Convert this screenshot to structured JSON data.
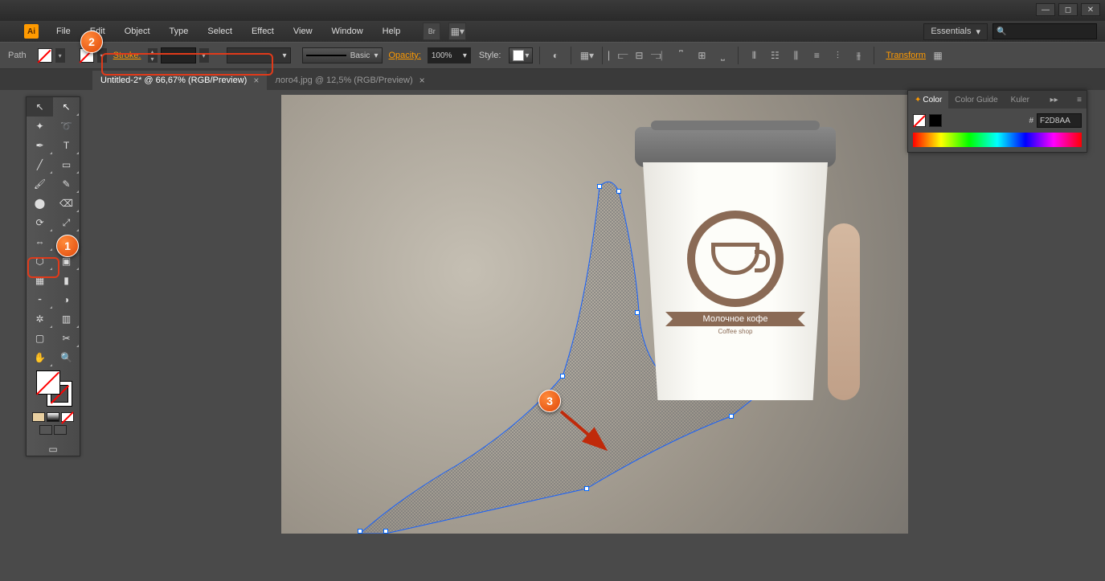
{
  "app": {
    "logo_text": "Ai"
  },
  "window_controls": {
    "minimize": "—",
    "maximize": "◻",
    "close": "✕"
  },
  "menu": [
    "File",
    "Edit",
    "Object",
    "Type",
    "Select",
    "Effect",
    "View",
    "Window",
    "Help"
  ],
  "workspace": {
    "label": "Essentials"
  },
  "control": {
    "selection_label": "Path",
    "stroke_label": "Stroke:",
    "stroke_weight": "",
    "brush_def": "Basic",
    "opacity_label": "Opacity:",
    "opacity_value": "100%",
    "style_label": "Style:",
    "transform_label": "Transform"
  },
  "tabs": [
    {
      "title": "Untitled-2* @ 66,67% (RGB/Preview)",
      "active": true
    },
    {
      "title": "лого4.jpg @ 12,5% (RGB/Preview)",
      "active": false
    }
  ],
  "tools": {
    "rows": [
      [
        "selection",
        "direct-selection"
      ],
      [
        "magic-wand",
        "lasso"
      ],
      [
        "pen",
        "type"
      ],
      [
        "line",
        "rectangle"
      ],
      [
        "paintbrush",
        "pencil"
      ],
      [
        "blob",
        "eraser"
      ],
      [
        "rotate",
        "scale"
      ],
      [
        "width",
        "free-transform"
      ],
      [
        "shape-builder",
        "perspective"
      ],
      [
        "mesh",
        "gradient"
      ],
      [
        "eyedropper",
        "blend"
      ],
      [
        "symbol",
        "column-graph"
      ],
      [
        "artboard",
        "slice"
      ],
      [
        "hand",
        "zoom"
      ]
    ]
  },
  "color_panel": {
    "tabs": [
      "Color",
      "Color Guide",
      "Kuler"
    ],
    "hex_prefix": "#",
    "hex_value": "F2D8AA"
  },
  "cup": {
    "brand": "Молочное кофе",
    "subtitle": "Coffee shop"
  },
  "callouts": {
    "c1": "1",
    "c2": "2",
    "c3": "3"
  }
}
